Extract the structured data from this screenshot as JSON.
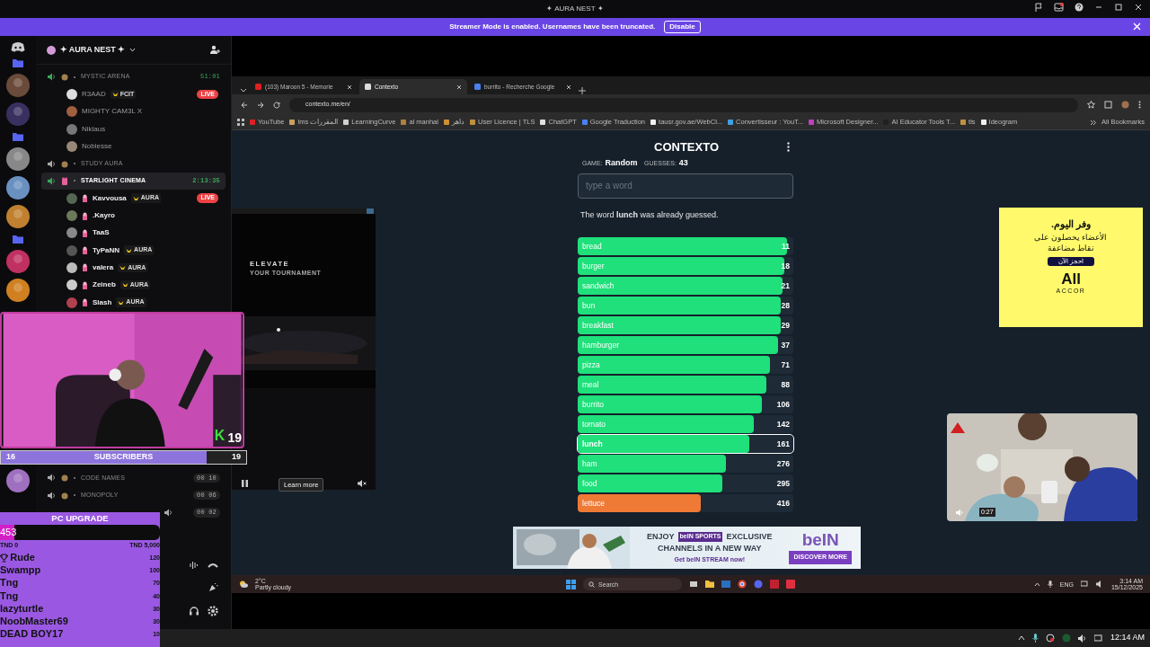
{
  "discord": {
    "title": "✦ AURA NEST ✦",
    "banner": {
      "text": "Streamer Mode is enabled. Usernames have been truncated.",
      "button": "Disable"
    },
    "server_name": "✦ AURA NEST ✦",
    "channels": [
      {
        "name": "MYSTIC ARENA",
        "timer": "51:01",
        "selected": false,
        "members": [
          {
            "name": "R3AAD",
            "badge": "FCIT",
            "status": "LIVE"
          },
          {
            "name": "MIGHTY CAM3L X"
          },
          {
            "name": "Niklaus"
          },
          {
            "name": "Noblesse"
          }
        ]
      },
      {
        "name": "STUDY AURA",
        "selected": false
      },
      {
        "name": "STARLIGHT CINEMA",
        "timer": "2:13:35",
        "selected": true,
        "members": [
          {
            "name": "Kavvousa",
            "badge": "AURA",
            "status": "LIVE"
          },
          {
            "name": ".Kayro"
          },
          {
            "name": "TaaS"
          },
          {
            "name": "TyPaNN",
            "badge": "AURA"
          },
          {
            "name": "valera",
            "badge": "AURA"
          },
          {
            "name": "Zeineb",
            "badge": "AURA"
          },
          {
            "name": "Slash",
            "badge": "AURA"
          }
        ]
      },
      {
        "name": "CODE NAMES",
        "timer": "00 10",
        "selected": false
      },
      {
        "name": "MONOPOLY",
        "timer": "00 06",
        "selected": false
      },
      {
        "timer": "00 02",
        "selected": false
      }
    ]
  },
  "webcam": {
    "kills_label": "K",
    "kills": "19",
    "subscribers": {
      "label": "SUBSCRIBERS",
      "current": "16",
      "goal": "19",
      "level": 0.84
    }
  },
  "goal_widget": {
    "title": "PC UPGRADE",
    "amount": "453",
    "level": 0.09,
    "min": "TND 0",
    "max": "TND 5,000",
    "donors": [
      {
        "name": "Rude",
        "amount": "120",
        "top": true
      },
      {
        "name": "Swampp",
        "amount": "100",
        "top": false
      },
      {
        "name": "Tng",
        "amount": "70",
        "top": false
      },
      {
        "name": "Tng",
        "amount": "40",
        "top": false
      },
      {
        "name": "lazyturtle",
        "amount": "30",
        "top": false
      },
      {
        "name": "NoobMaster69",
        "amount": "30",
        "top": false
      },
      {
        "name": "DEAD BOY17",
        "amount": "10",
        "top": false
      }
    ]
  },
  "browser": {
    "tabs": [
      {
        "title": "(103) Maroon 5 - Memorie",
        "selected": false
      },
      {
        "title": "Contexto",
        "selected": true
      },
      {
        "title": "burrito - Recherche Google",
        "selected": false
      }
    ],
    "url": "contexto.me/en/",
    "bookmarks": [
      {
        "label": "YouTube",
        "color": "#e02020"
      },
      {
        "label": "lms المقررات",
        "color": "#c8a060"
      },
      {
        "label": "LearningCurve",
        "color": "#d0d0d0"
      },
      {
        "label": "al manhal",
        "color": "#b08040"
      },
      {
        "label": "داهر",
        "color": "#d09030"
      },
      {
        "label": "User Licence | TLS",
        "color": "#c09040"
      },
      {
        "label": "ChatGPT",
        "color": "#e0e0e0"
      },
      {
        "label": "Google Traduction",
        "color": "#4a80f0"
      },
      {
        "label": "tausr.gov.ae/WebCl...",
        "color": "#f0f0f0"
      },
      {
        "label": "Convertisseur : YouT...",
        "color": "#40a0e0"
      },
      {
        "label": "Microsoft Designer...",
        "color": "#c040c0"
      },
      {
        "label": "AI Educator Tools T...",
        "color": "#202020"
      },
      {
        "label": "tls",
        "color": "#c09040"
      },
      {
        "label": "Ideogram",
        "color": "#f0f0f0"
      }
    ],
    "all_bookmarks": "All Bookmarks",
    "page": {
      "title": "CONTEXTO",
      "game_label": "GAME:",
      "game": "Random",
      "guesses_label": "GUESSES:",
      "guesses_count": "43",
      "input": {
        "placeholder": "type a word"
      },
      "message": "The word **lunch** was already guessed.",
      "guesses": [
        {
          "word": "bread",
          "rank": "11",
          "level": 1.0,
          "color": "#1fe07a",
          "selected": false
        },
        {
          "word": "burger",
          "rank": "18",
          "level": 0.99,
          "color": "#1fe07a",
          "selected": false
        },
        {
          "word": "sandwich",
          "rank": "21",
          "level": 0.98,
          "color": "#1fe07a",
          "selected": false
        },
        {
          "word": "bun",
          "rank": "28",
          "level": 0.97,
          "color": "#1fe07a",
          "selected": false
        },
        {
          "word": "breakfast",
          "rank": "29",
          "level": 0.97,
          "color": "#1fe07a",
          "selected": false
        },
        {
          "word": "hamburger",
          "rank": "37",
          "level": 0.96,
          "color": "#1fe07a",
          "selected": false
        },
        {
          "word": "pizza",
          "rank": "71",
          "level": 0.92,
          "color": "#1fe07a",
          "selected": false
        },
        {
          "word": "meal",
          "rank": "88",
          "level": 0.9,
          "color": "#1fe07a",
          "selected": false
        },
        {
          "word": "burrito",
          "rank": "106",
          "level": 0.88,
          "color": "#1fe07a",
          "selected": false
        },
        {
          "word": "tomato",
          "rank": "142",
          "level": 0.84,
          "color": "#1fe07a",
          "selected": false
        },
        {
          "word": "lunch",
          "rank": "161",
          "level": 0.82,
          "color": "#1fe07a",
          "selected": true
        },
        {
          "word": "ham",
          "rank": "276",
          "level": 0.71,
          "color": "#1fe07a",
          "selected": false
        },
        {
          "word": "food",
          "rank": "295",
          "level": 0.69,
          "color": "#1fe07a",
          "selected": false
        },
        {
          "word": "lettuce",
          "rank": "416",
          "level": 0.59,
          "color": "#ef7a35",
          "selected": false
        }
      ]
    },
    "left_ad": {
      "headline": "ELEVATE",
      "subline": "YOUR TOURNAMENT",
      "button": "Learn more"
    },
    "right_ad": {
      "headline": "وفر اليوم.",
      "body": "الأعضاء يحصلون على نقاط مضاعفة",
      "button": "احجز الآن",
      "logo": "All",
      "brand": "ACCOR"
    },
    "video_ad": {
      "time": "0:27"
    },
    "bottom_ad": {
      "enjoy": "ENJOY",
      "logo_box": "beIN SPORTS",
      "exclusive": "EXCLUSIVE",
      "line2": "CHANNELS IN A NEW WAY",
      "tagline": "Get beIN STREAM now!",
      "logo": "beIN",
      "button": "DISCOVER MORE"
    }
  },
  "desktop_taskbar": {
    "temperature": "2°C",
    "weather": "Partly cloudy",
    "search": "Search",
    "language": "ENG",
    "time": "3:14 AM",
    "date": "15/12/2025"
  },
  "system_tray": {
    "time": "12:14 AM"
  }
}
